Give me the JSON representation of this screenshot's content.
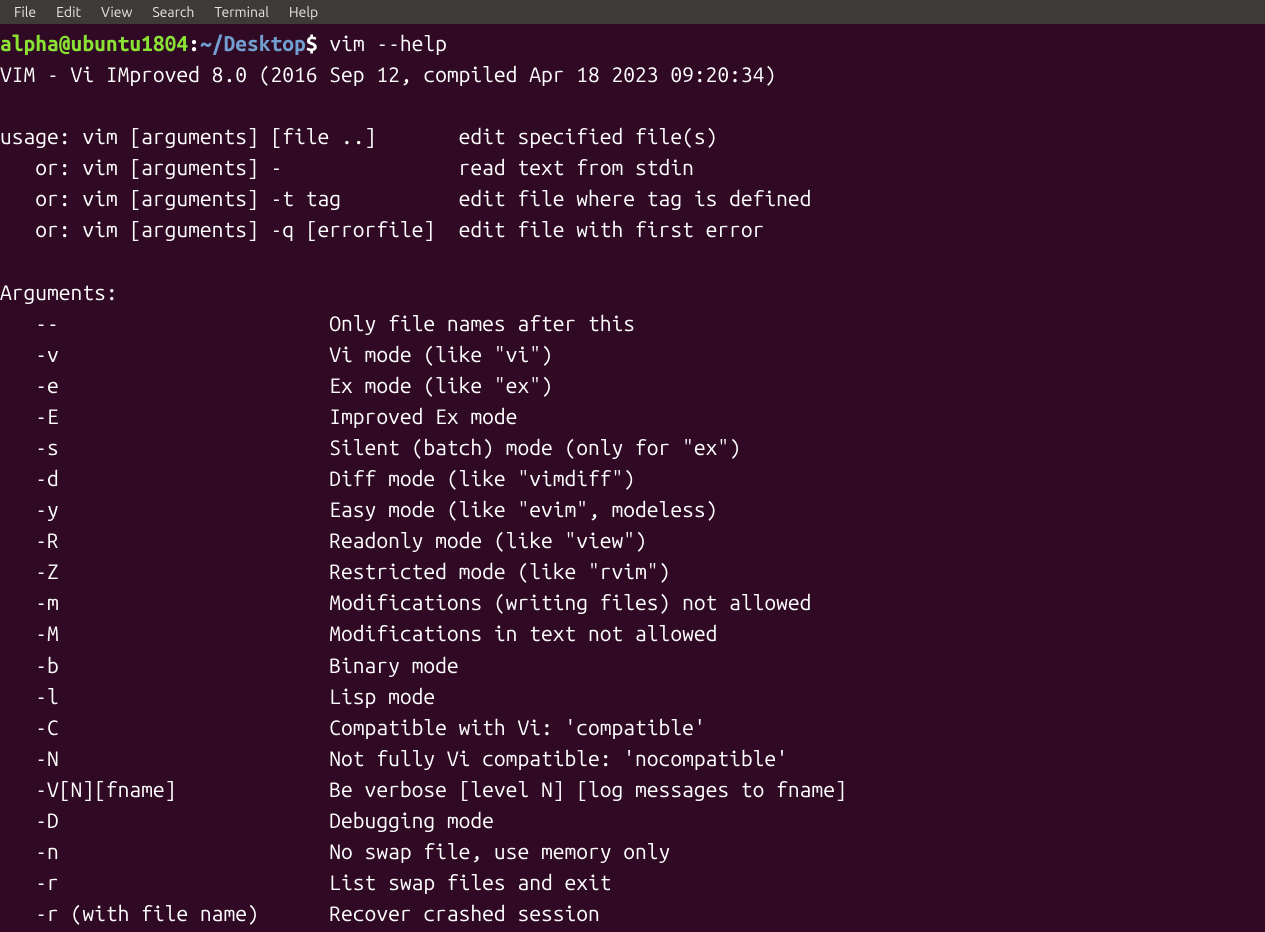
{
  "menubar": {
    "items": [
      "File",
      "Edit",
      "View",
      "Search",
      "Terminal",
      "Help"
    ]
  },
  "prompt": {
    "user_host": "alpha@ubuntu1804",
    "colon": ":",
    "path": "~/Desktop",
    "dollar": "$ "
  },
  "command": "vim --help",
  "output": {
    "version": "VIM - Vi IMproved 8.0 (2016 Sep 12, compiled Apr 18 2023 09:20:34)",
    "blank1": "",
    "usage_lines": [
      "usage: vim [arguments] [file ..]       edit specified file(s)",
      "   or: vim [arguments] -               read text from stdin",
      "   or: vim [arguments] -t tag          edit file where tag is defined",
      "   or: vim [arguments] -q [errorfile]  edit file with first error"
    ],
    "blank2": "",
    "args_header": "Arguments:",
    "args": [
      {
        "flag": "--",
        "desc": "Only file names after this"
      },
      {
        "flag": "-v",
        "desc": "Vi mode (like \"vi\")"
      },
      {
        "flag": "-e",
        "desc": "Ex mode (like \"ex\")"
      },
      {
        "flag": "-E",
        "desc": "Improved Ex mode"
      },
      {
        "flag": "-s",
        "desc": "Silent (batch) mode (only for \"ex\")"
      },
      {
        "flag": "-d",
        "desc": "Diff mode (like \"vimdiff\")"
      },
      {
        "flag": "-y",
        "desc": "Easy mode (like \"evim\", modeless)"
      },
      {
        "flag": "-R",
        "desc": "Readonly mode (like \"view\")"
      },
      {
        "flag": "-Z",
        "desc": "Restricted mode (like \"rvim\")"
      },
      {
        "flag": "-m",
        "desc": "Modifications (writing files) not allowed"
      },
      {
        "flag": "-M",
        "desc": "Modifications in text not allowed"
      },
      {
        "flag": "-b",
        "desc": "Binary mode"
      },
      {
        "flag": "-l",
        "desc": "Lisp mode"
      },
      {
        "flag": "-C",
        "desc": "Compatible with Vi: 'compatible'"
      },
      {
        "flag": "-N",
        "desc": "Not fully Vi compatible: 'nocompatible'"
      },
      {
        "flag": "-V[N][fname]",
        "desc": "Be verbose [level N] [log messages to fname]"
      },
      {
        "flag": "-D",
        "desc": "Debugging mode"
      },
      {
        "flag": "-n",
        "desc": "No swap file, use memory only"
      },
      {
        "flag": "-r",
        "desc": "List swap files and exit"
      },
      {
        "flag": "-r (with file name)",
        "desc": "Recover crashed session"
      }
    ]
  },
  "layout": {
    "flag_col_width": 25,
    "indent": "   "
  }
}
